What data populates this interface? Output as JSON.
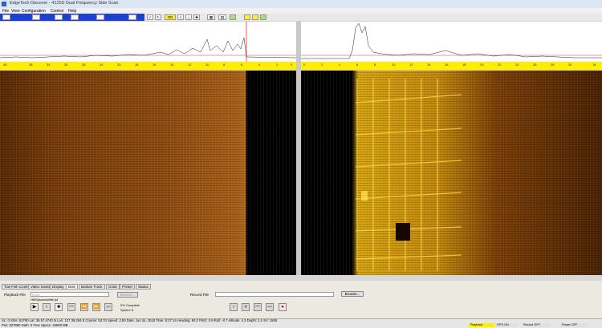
{
  "window": {
    "title": "EdgeTech Discover - 4125D Dual Frequency Side Scan"
  },
  "menu": [
    "File",
    "View",
    "Configuration",
    "Control",
    "Help"
  ],
  "toolbar": {
    "on_label": "ON"
  },
  "rulers": {
    "left_ticks": [
      "45",
      "38",
      "34",
      "30",
      "28",
      "24",
      "20",
      "18",
      "16",
      "14",
      "12",
      "10",
      "8",
      "6",
      "4",
      "2",
      "0"
    ],
    "right_ticks": [
      "0",
      "2",
      "4",
      "6",
      "8",
      "10",
      "12",
      "14",
      "16",
      "18",
      "20",
      "22",
      "24",
      "26",
      "28",
      "30",
      "M"
    ]
  },
  "tabs": [
    "Tow Fish Control",
    "Video Gains",
    "Display",
    "Disk",
    "Bottom Track",
    "Grids",
    "Printer",
    "Status"
  ],
  "active_tab": "Disk",
  "playback": {
    "label": "Playback File",
    "field_value": "RLAY",
    "browse": "Browse...",
    "file_name": "HMSyssonahfile.jsf",
    "status_line1": "0% Complete",
    "status_line2": "Speed: 8"
  },
  "record": {
    "label": "Record File",
    "browse": "Browse..."
  },
  "status_bar": {
    "row1": "SL: 0  SSH: 52760   Lat: 36 57.4740 N   Lon: 137 39.284 E   Course: 53.70   Speed: 2.50   Date: Jun 24, 2018   Time: 5:27:14   Heading: 60.2   Pitch: 0.9   Roll: -0.7   Altitude: 4.3   Depth: 2.2   SV: 1500",
    "row2": "Pos: 527960   Nath: 0   Free Space: 34600 MB",
    "indicators": [
      {
        "label": "Playback",
        "color": "#ffee00"
      },
      {
        "label": "GPS ON",
        "color": "#e0e0e0"
      },
      {
        "label": "Record OFF",
        "color": "#e0e0e0"
      },
      {
        "label": "Power OFF",
        "color": "#e0e0e0"
      }
    ]
  },
  "colors": {
    "sonar_accent": "#d8a412",
    "ruler": "#ffee00",
    "toolbar_blue": "#1e40d0"
  }
}
